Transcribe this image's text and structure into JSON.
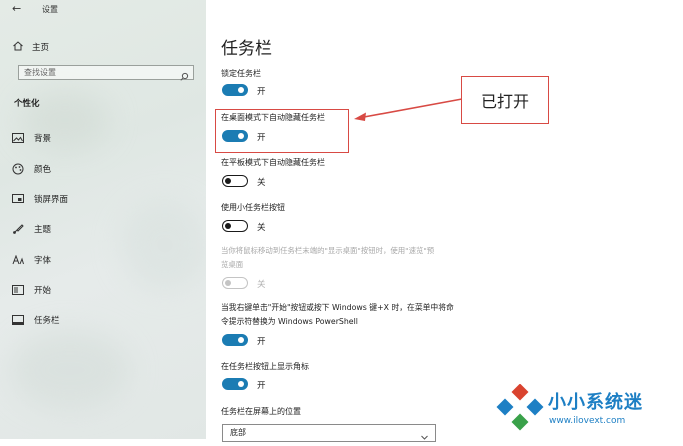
{
  "window": {
    "back_glyph": "←",
    "title": "设置"
  },
  "sidebar": {
    "home_label": "主页",
    "search_placeholder": "查找设置",
    "section_title": "个性化",
    "items": [
      {
        "label": "背景",
        "icon": "image-icon"
      },
      {
        "label": "颜色",
        "icon": "palette-icon"
      },
      {
        "label": "锁屏界面",
        "icon": "lock-screen-icon"
      },
      {
        "label": "主题",
        "icon": "brush-icon"
      },
      {
        "label": "字体",
        "icon": "font-icon"
      },
      {
        "label": "开始",
        "icon": "start-icon"
      },
      {
        "label": "任务栏",
        "icon": "taskbar-icon",
        "selected": true
      }
    ]
  },
  "main": {
    "title": "任务栏",
    "settings": [
      {
        "label": "锁定任务栏",
        "state": "开",
        "on": true
      },
      {
        "label": "在桌面模式下自动隐藏任务栏",
        "state": "开",
        "on": true
      },
      {
        "label": "在平板模式下自动隐藏任务栏",
        "state": "关",
        "on": false
      },
      {
        "label": "使用小任务栏按钮",
        "state": "关",
        "on": false
      },
      {
        "label_line1": "当你将鼠标移动到任务栏末端的\"显示桌面\"按钮时，使用\"速览\"预",
        "label_line2": "览桌面",
        "state": "关",
        "on": false,
        "disabled": true
      },
      {
        "label_line1": "当我右键单击\"开始\"按钮或按下 Windows 键+X 时，在菜单中将命",
        "label_line2": "令提示符替换为 Windows PowerShell",
        "state": "开",
        "on": true
      },
      {
        "label": "在任务栏按钮上显示角标",
        "state": "开",
        "on": true
      }
    ],
    "position_label": "任务栏在屏幕上的位置",
    "position_value": "底部"
  },
  "annotation": {
    "callout_text": "已打开",
    "color": "#d84a44"
  },
  "watermark": {
    "name": "小小系统迷",
    "url": "www.ilovext.com"
  },
  "colors": {
    "accent": "#1b7cb3",
    "watermark": "#1d7fc4"
  }
}
